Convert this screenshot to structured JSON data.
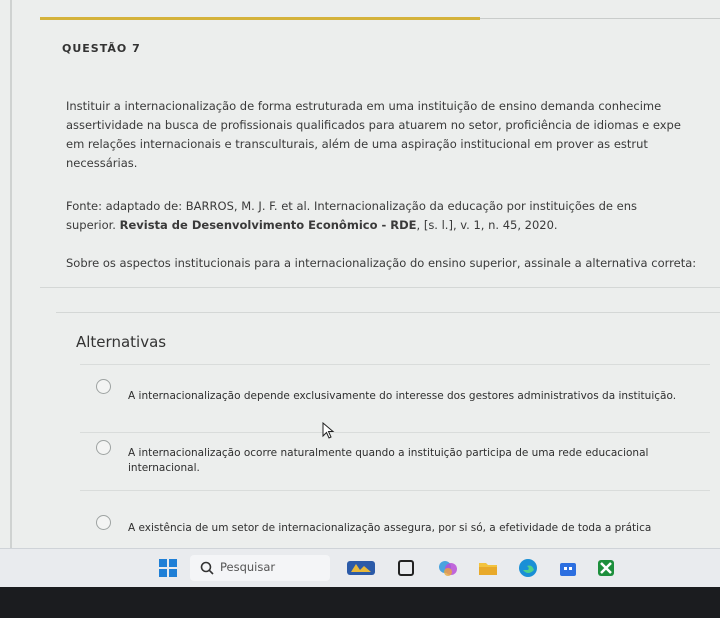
{
  "question": {
    "title": "QUESTÃO 7",
    "statement_lines": [
      "Instituir a internacionalização de forma estruturada em uma instituição de ensino demanda conhecime",
      "assertividade na busca de profissionais qualificados para atuarem no setor, proficiência de idiomas e expe",
      "em relações internacionais e transculturais, além de uma aspiração institucional em prover as estrut",
      "necessárias."
    ],
    "source_line1": "Fonte: adaptado de: BARROS, M. J. F. et al. Internacionalização da educação por instituições de ens",
    "source_line2_prefix": "superior. ",
    "source_line2_bold": "Revista de Desenvolvimento Econômico - RDE",
    "source_line2_suffix": ", [s. l.], v. 1, n. 45, 2020.",
    "prompt": "Sobre os aspectos institucionais para a internacionalização do ensino superior, assinale a alternativa correta:"
  },
  "alternatives": {
    "heading": "Alternativas",
    "items": [
      {
        "line1": "A internacionalização depende exclusivamente do interesse dos gestores administrativos da instituição.",
        "line2": ""
      },
      {
        "line1": "A internacionalização ocorre naturalmente quando a instituição participa de uma rede educacional",
        "line2": "internacional."
      },
      {
        "line1": "A existência de um setor de internacionalização assegura, por si só, a efetividade de toda a prática",
        "line2": ""
      }
    ]
  },
  "taskbar": {
    "search_label": "Pesquisar"
  },
  "colors": {
    "accent": "#d4b23b",
    "background": "#eceeed"
  }
}
